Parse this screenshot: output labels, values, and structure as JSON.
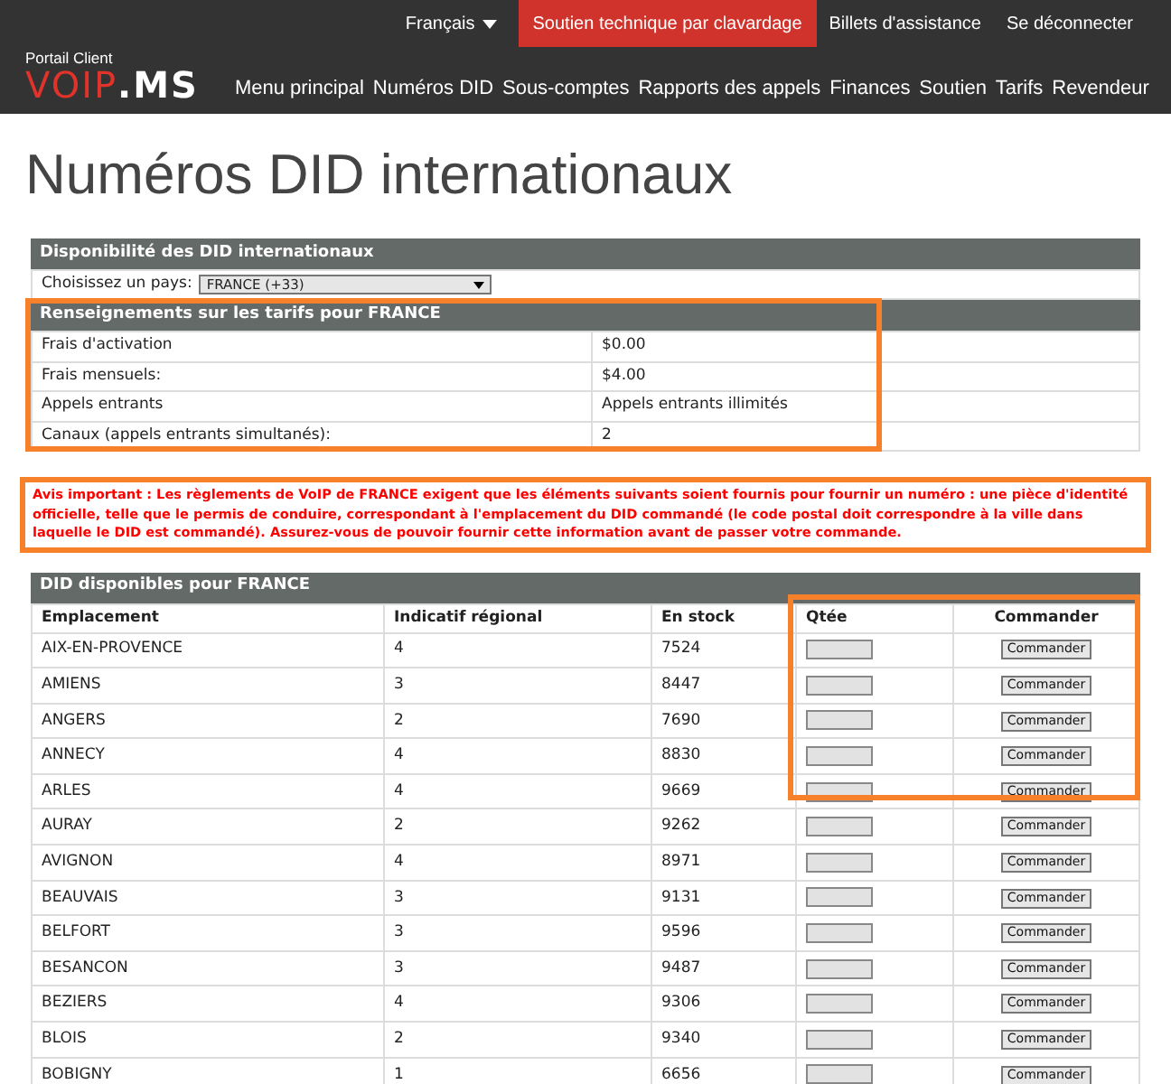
{
  "top_bar": {
    "language": "Français",
    "chat_button": "Soutien technique par clavardage",
    "links": [
      "Billets d'assistance",
      "Se déconnecter"
    ]
  },
  "logo": {
    "caption": "Portail Client",
    "wordmark": [
      "VOIP",
      ".MS"
    ]
  },
  "nav": [
    "Menu principal",
    "Numéros DID",
    "Sous-comptes",
    "Rapports des appels",
    "Finances",
    "Soutien",
    "Tarifs",
    "Revendeur"
  ],
  "page_title": "Numéros DID internationaux",
  "availability": {
    "title": "Disponibilité des DID internationaux",
    "country_label": "Choisissez un pays:",
    "country_value": "FRANCE (+33)"
  },
  "rates": {
    "title": "Renseignements sur les tarifs pour FRANCE",
    "rows": [
      {
        "label": "Frais d'activation",
        "value": "$0.00"
      },
      {
        "label": "Frais mensuels:",
        "value": "$4.00"
      },
      {
        "label": "Appels entrants",
        "value": "Appels entrants illimités"
      },
      {
        "label": "Canaux (appels entrants simultanés):",
        "value": "2"
      }
    ]
  },
  "notice": "Avis important : Les règlements de VoIP de FRANCE exigent que les éléments suivants soient fournis pour fournir un numéro : une pièce d'identité officielle, telle que le permis de conduire, correspondant à l'emplacement du DID commandé (le code postal doit correspondre à la ville dans laquelle le DID est commandé). Assurez-vous de pouvoir fournir cette information avant de passer votre commande.",
  "dids": {
    "title": "DID disponibles pour FRANCE",
    "columns": [
      "Emplacement",
      "Indicatif régional",
      "En stock",
      "Qtée",
      "Commander"
    ],
    "rows": [
      {
        "location": "AIX-EN-PROVENCE",
        "region": "4",
        "stock": "7524",
        "order_button": "Commander"
      },
      {
        "location": "AMIENS",
        "region": "3",
        "stock": "8447",
        "order_button": "Commander"
      },
      {
        "location": "ANGERS",
        "region": "2",
        "stock": "7690",
        "order_button": "Commander"
      },
      {
        "location": "ANNECY",
        "region": "4",
        "stock": "8830",
        "order_button": "Commander"
      },
      {
        "location": "ARLES",
        "region": "4",
        "stock": "9669",
        "order_button": "Commander"
      },
      {
        "location": "AURAY",
        "region": "2",
        "stock": "9262",
        "order_button": "Commander"
      },
      {
        "location": "AVIGNON",
        "region": "4",
        "stock": "8971",
        "order_button": "Commander"
      },
      {
        "location": "BEAUVAIS",
        "region": "3",
        "stock": "9131",
        "order_button": "Commander"
      },
      {
        "location": "BELFORT",
        "region": "3",
        "stock": "9596",
        "order_button": "Commander"
      },
      {
        "location": "BESANCON",
        "region": "3",
        "stock": "9487",
        "order_button": "Commander"
      },
      {
        "location": "BEZIERS",
        "region": "4",
        "stock": "9306",
        "order_button": "Commander"
      },
      {
        "location": "BLOIS",
        "region": "2",
        "stock": "9340",
        "order_button": "Commander"
      },
      {
        "location": "BOBIGNY",
        "region": "1",
        "stock": "6656",
        "order_button": "Commander"
      }
    ]
  }
}
